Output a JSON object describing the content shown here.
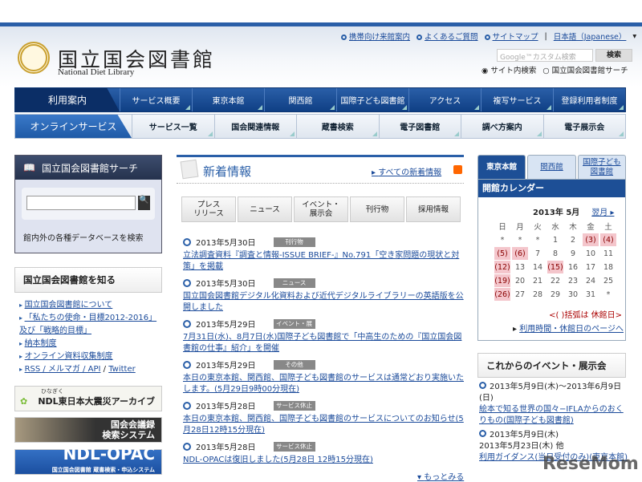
{
  "header": {
    "logo_jp": "国立国会図書館",
    "logo_en": "National Diet Library",
    "top_links": [
      "携帯向け来館案内",
      "よくあるご質問",
      "サイトマップ"
    ],
    "language": "日本語（Japanese）",
    "search_placeholder": "Google™カスタム検索",
    "search_button": "検索",
    "radio_site": "サイト内検索",
    "radio_ndl": "国立国会図書館サーチ"
  },
  "nav1": {
    "lead": "利用案内",
    "items": [
      "サービス概要",
      "東京本館",
      "関西館",
      "国際子ども図書館",
      "アクセス",
      "複写サービス",
      "登録利用者制度"
    ]
  },
  "nav2": {
    "lead": "オンラインサービス",
    "items": [
      "サービス一覧",
      "国会関連情報",
      "蔵書検索",
      "電子図書館",
      "調べ方案内",
      "電子展示会"
    ]
  },
  "left": {
    "search_title": "国立国会図書館サーチ",
    "search_button_icon": "🔍",
    "search_desc": "館内外の各種データベースを検索",
    "know_title": "国立国会図書館を知る",
    "know_links": [
      "国立国会図書館について",
      "「私たちの使命・目標2012-2016」及び「戦略的目標」",
      "納本制度",
      "オンライン資料収集制度"
    ],
    "rss_links": [
      "RSS / メルマガ / API",
      "Twitter"
    ],
    "banners": {
      "hinagiku": "NDL東日本大震災アーカイブ",
      "hinagiku_kana": "ひなぎく",
      "kokkai": "国会会議録\n検索システム",
      "opac": "NDL-OPAC",
      "opac_sub": "国立国会図書館 蔵書検索・申込システム"
    }
  },
  "news": {
    "title": "新着情報",
    "all_link": "すべての新着情報",
    "tabs": [
      "プレス\nリリース",
      "ニュース",
      "イベント・\n展示会",
      "刊行物",
      "採用情報"
    ],
    "items": [
      {
        "date": "2013年5月30日",
        "tag": "刊行物",
        "text": "立法調査資料『調査と情報-ISSUE BRIEF-』No.791「空き家問題の現状と対策」を掲載"
      },
      {
        "date": "2013年5月30日",
        "tag": "ニュース",
        "text": "国立国会図書館デジタル化資料および近代デジタルライブラリーの英語版を公開しました"
      },
      {
        "date": "2013年5月29日",
        "tag": "イベント・展示会",
        "text": "7月31日(水)、8月7日(水)国際子ども図書館で「中高生のための『国立国会図書館の仕事』紹介」を開催"
      },
      {
        "date": "2013年5月29日",
        "tag": "その他",
        "text": "本日の東京本館、関西館、国際子ども図書館のサービスは通常どおり実施いたします。(5月29日9時00分現在)"
      },
      {
        "date": "2013年5月28日",
        "tag": "サービス休止",
        "text": "本日の東京本館、関西館、国際子ども図書館のサービスについてのお知らせ(5月28日12時15分現在)"
      },
      {
        "date": "2013年5月28日",
        "tag": "サービス休止",
        "text": "NDL-OPACは復旧しました(5月28日 12時15分現在)"
      }
    ],
    "more": "もっとみる"
  },
  "calendar": {
    "tabs": [
      "東京本館",
      "関西館",
      "国際子ども\n図書館"
    ],
    "title": "開館カレンダー",
    "month": "2013年 5月",
    "next": "翌月 ▸",
    "weekdays": [
      "日",
      "月",
      "火",
      "水",
      "木",
      "金",
      "土"
    ],
    "weeks": [
      [
        "*",
        "*",
        "*",
        "1",
        "2",
        "(3)",
        "(4)"
      ],
      [
        "(5)",
        "(6)",
        "7",
        "8",
        "9",
        "10",
        "11"
      ],
      [
        "(12)",
        "13",
        "14",
        "(15)",
        "16",
        "17",
        "18"
      ],
      [
        "(19)",
        "20",
        "21",
        "22",
        "23",
        "24",
        "25"
      ],
      [
        "(26)",
        "27",
        "28",
        "29",
        "30",
        "31",
        "*"
      ]
    ],
    "note": "<( )括弧は 休館日>",
    "link": "利用時間・休館日のページへ"
  },
  "events": {
    "title": "これからのイベント・展示会",
    "items": [
      {
        "date": "2013年5月9日(木)〜2013年6月9日(日)",
        "text": "絵本で知る世界の国々−IFLAからのおくりもの(国際子ども図書館)"
      },
      {
        "date": "2013年5月9日(木)\n2013年5月23日(木) 他",
        "text": "利用ガイダンス(当日受付のみ)(東京本館)"
      }
    ]
  },
  "watermark": "ReseMom"
}
